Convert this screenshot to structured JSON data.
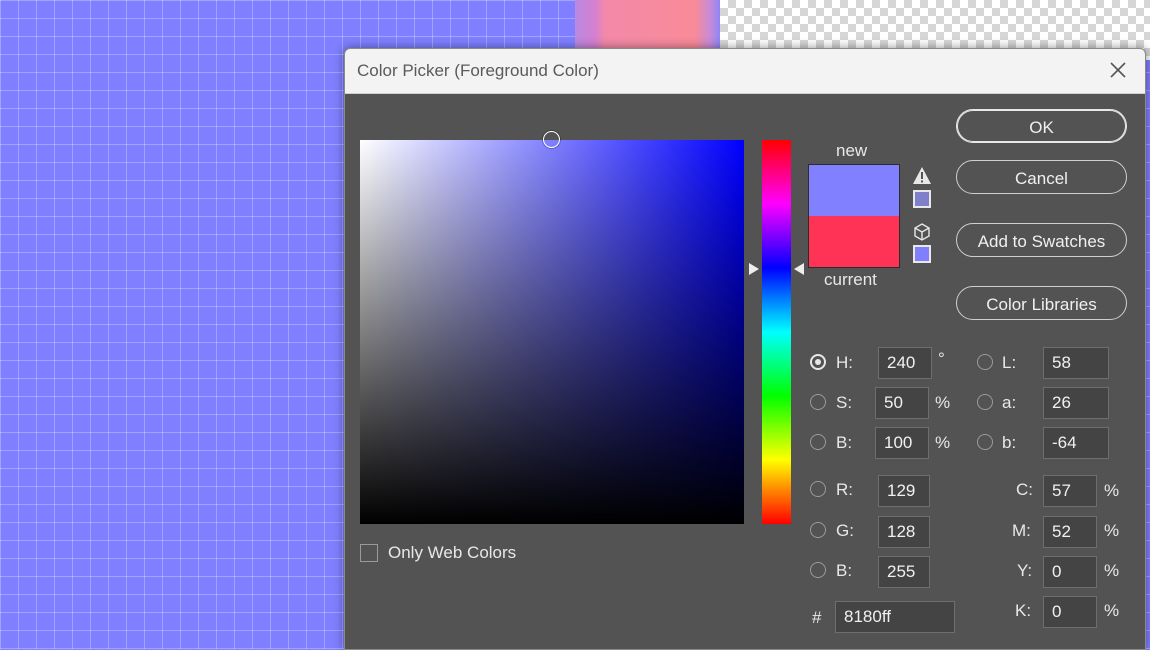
{
  "dialog": {
    "title": "Color Picker (Foreground Color)",
    "close_icon": "close-icon"
  },
  "preview": {
    "new_label": "new",
    "current_label": "current",
    "new_color": "#8180ff",
    "current_color": "#ff3355",
    "gamut_warning_icon": "warning-icon",
    "gamut_swatch_color": "#7f7fcc",
    "web_safe_icon": "cube-icon",
    "web_safe_swatch_color": "#8080ff"
  },
  "buttons": {
    "ok": "OK",
    "cancel": "Cancel",
    "add_to_swatches": "Add to Swatches",
    "color_libraries": "Color Libraries"
  },
  "hsb": {
    "h_label": "H:",
    "h_value": "240",
    "h_unit": "°",
    "s_label": "S:",
    "s_value": "50",
    "s_unit": "%",
    "b_label": "B:",
    "b_value": "100",
    "b_unit": "%"
  },
  "rgb": {
    "r_label": "R:",
    "r_value": "129",
    "g_label": "G:",
    "g_value": "128",
    "b_label": "B:",
    "b_value": "255"
  },
  "lab": {
    "l_label": "L:",
    "l_value": "58",
    "a_label": "a:",
    "a_value": "26",
    "b_label": "b:",
    "b_value": "-64"
  },
  "cmyk": {
    "c_label": "C:",
    "c_value": "57",
    "c_unit": "%",
    "m_label": "M:",
    "m_value": "52",
    "m_unit": "%",
    "y_label": "Y:",
    "y_value": "0",
    "y_unit": "%",
    "k_label": "K:",
    "k_value": "0",
    "k_unit": "%"
  },
  "hex": {
    "label": "#",
    "value": "8180ff"
  },
  "web_colors": {
    "label": "Only Web Colors",
    "checked": false
  },
  "selected_mode": "H"
}
